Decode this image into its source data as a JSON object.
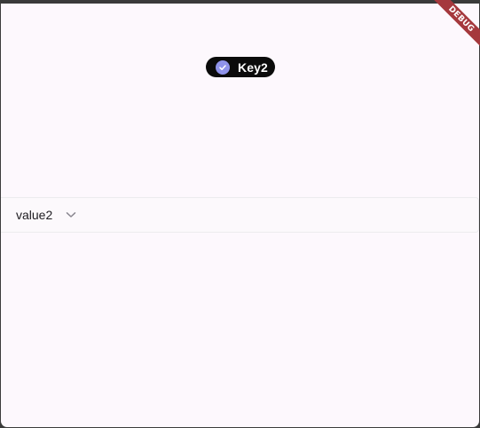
{
  "chip": {
    "label": "Key2",
    "selected": true,
    "icon": "check-icon",
    "background": "#0b0b0b",
    "check_color": "#8f93ea"
  },
  "dropdown": {
    "value": "value2",
    "icon": "chevron-down-icon"
  },
  "debug_banner": {
    "label": "DEBUG",
    "color": "#a5383d"
  },
  "theme": {
    "surface": "#fdf8fd",
    "frame": "#3a3a3a"
  }
}
